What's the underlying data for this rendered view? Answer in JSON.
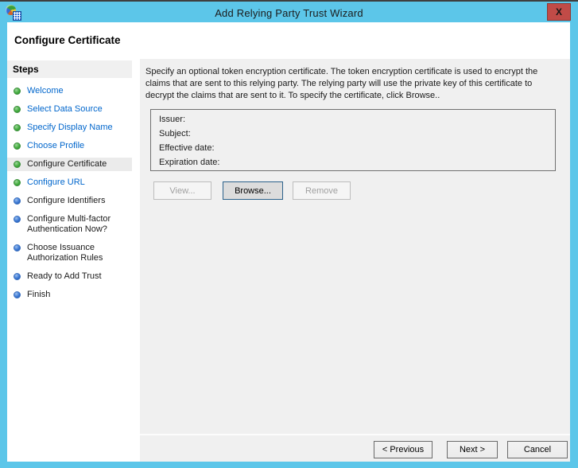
{
  "titlebar": {
    "title": "Add Relying Party Trust Wizard",
    "close_glyph": "X"
  },
  "header": {
    "title": "Configure Certificate"
  },
  "sidebar": {
    "title": "Steps",
    "items": [
      {
        "label": "Welcome",
        "bullet": "green",
        "state": "link"
      },
      {
        "label": "Select Data Source",
        "bullet": "green",
        "state": "link"
      },
      {
        "label": "Specify Display Name",
        "bullet": "green",
        "state": "link"
      },
      {
        "label": "Choose Profile",
        "bullet": "green",
        "state": "link"
      },
      {
        "label": "Configure Certificate",
        "bullet": "green",
        "state": "current"
      },
      {
        "label": "Configure URL",
        "bullet": "green",
        "state": "link"
      },
      {
        "label": "Configure Identifiers",
        "bullet": "blue",
        "state": "upcoming"
      },
      {
        "label": "Configure Multi-factor\nAuthentication Now?",
        "bullet": "blue",
        "state": "upcoming"
      },
      {
        "label": "Choose Issuance\nAuthorization Rules",
        "bullet": "blue",
        "state": "upcoming"
      },
      {
        "label": "Ready to Add Trust",
        "bullet": "blue",
        "state": "upcoming"
      },
      {
        "label": "Finish",
        "bullet": "blue",
        "state": "upcoming"
      }
    ]
  },
  "main": {
    "instruction": "Specify an optional token encryption certificate.  The token encryption certificate is used to encrypt the claims that are sent to this relying party.  The relying party will use the private key of this certificate to decrypt the claims that are sent to it.  To specify the certificate, click Browse..",
    "certificate_fields": [
      {
        "label": "Issuer:",
        "value": ""
      },
      {
        "label": "Subject:",
        "value": ""
      },
      {
        "label": "Effective date:",
        "value": ""
      },
      {
        "label": "Expiration date:",
        "value": ""
      }
    ],
    "buttons": {
      "view": {
        "label": "View...",
        "enabled": false
      },
      "browse": {
        "label": "Browse...",
        "enabled": true
      },
      "remove": {
        "label": "Remove",
        "enabled": false
      }
    }
  },
  "footer": {
    "previous": "< Previous",
    "next": "Next >",
    "cancel": "Cancel"
  },
  "colors": {
    "titlebar_frame": "#5CC6E9",
    "close_button": "#C14B47",
    "panel": "#F0F0F0",
    "link": "#0066CC",
    "bullet_done": "#3FAE41",
    "bullet_upcoming": "#2D6FD2",
    "browse_focus_border": "#2C628B"
  }
}
